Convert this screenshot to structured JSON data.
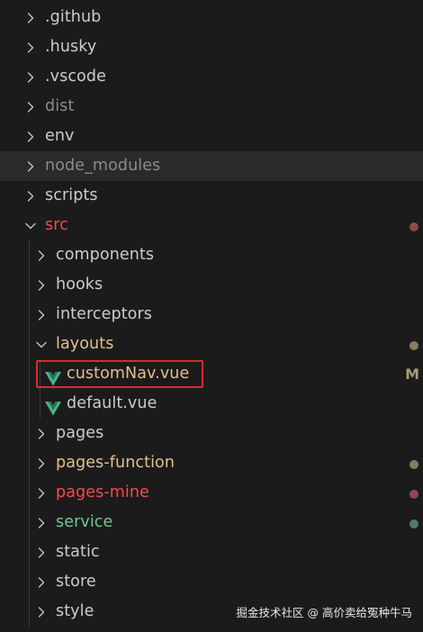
{
  "colors": {
    "background": "#1b1b1c",
    "text_default": "#cccccc",
    "text_ignored": "#8b8b8b",
    "text_modified": "#e2c08d",
    "text_error": "#f14c4c",
    "text_untracked": "#73c991",
    "vue_icon": "#41b883",
    "highlight_box": "#e0282b"
  },
  "explorer": {
    "items": [
      {
        "label": ".github",
        "depth": 0,
        "kind": "folder",
        "expanded": false,
        "color": "#cccccc"
      },
      {
        "label": ".husky",
        "depth": 0,
        "kind": "folder",
        "expanded": false,
        "color": "#cccccc"
      },
      {
        "label": ".vscode",
        "depth": 0,
        "kind": "folder",
        "expanded": false,
        "color": "#cccccc"
      },
      {
        "label": "dist",
        "depth": 0,
        "kind": "folder",
        "expanded": false,
        "color": "#8b8b8b"
      },
      {
        "label": "env",
        "depth": 0,
        "kind": "folder",
        "expanded": false,
        "color": "#cccccc"
      },
      {
        "label": "node_modules",
        "depth": 0,
        "kind": "folder",
        "expanded": false,
        "color": "#8b8b8b",
        "selected": true
      },
      {
        "label": "scripts",
        "depth": 0,
        "kind": "folder",
        "expanded": false,
        "color": "#cccccc"
      },
      {
        "label": "src",
        "depth": 0,
        "kind": "folder",
        "expanded": true,
        "color": "#f14c4c",
        "dot": "#8c4a4a"
      },
      {
        "label": "components",
        "depth": 1,
        "kind": "folder",
        "expanded": false,
        "color": "#cccccc"
      },
      {
        "label": "hooks",
        "depth": 1,
        "kind": "folder",
        "expanded": false,
        "color": "#cccccc"
      },
      {
        "label": "interceptors",
        "depth": 1,
        "kind": "folder",
        "expanded": false,
        "color": "#cccccc"
      },
      {
        "label": "layouts",
        "depth": 1,
        "kind": "folder",
        "expanded": true,
        "color": "#e2c08d",
        "dot": "#8a7a5e"
      },
      {
        "label": "customNav.vue",
        "depth": 2,
        "kind": "vue",
        "color": "#e2c08d",
        "badge": "M",
        "badge_color": "#a89a7c",
        "highlighted": true
      },
      {
        "label": "default.vue",
        "depth": 2,
        "kind": "vue",
        "color": "#cccccc"
      },
      {
        "label": "pages",
        "depth": 1,
        "kind": "folder",
        "expanded": false,
        "color": "#cccccc"
      },
      {
        "label": "pages-function",
        "depth": 1,
        "kind": "folder",
        "expanded": false,
        "color": "#e2c08d",
        "dot": "#8a7a5e"
      },
      {
        "label": "pages-mine",
        "depth": 1,
        "kind": "folder",
        "expanded": false,
        "color": "#f14c4c",
        "dot": "#8c4a4a"
      },
      {
        "label": "service",
        "depth": 1,
        "kind": "folder",
        "expanded": false,
        "color": "#73c991",
        "dot": "#4e7d5e"
      },
      {
        "label": "static",
        "depth": 1,
        "kind": "folder",
        "expanded": false,
        "color": "#cccccc"
      },
      {
        "label": "store",
        "depth": 1,
        "kind": "folder",
        "expanded": false,
        "color": "#cccccc"
      },
      {
        "label": "style",
        "depth": 1,
        "kind": "folder",
        "expanded": false,
        "color": "#cccccc"
      }
    ]
  },
  "watermark": {
    "text": "掘金技术社区 @ 高价卖给冤种牛马"
  }
}
